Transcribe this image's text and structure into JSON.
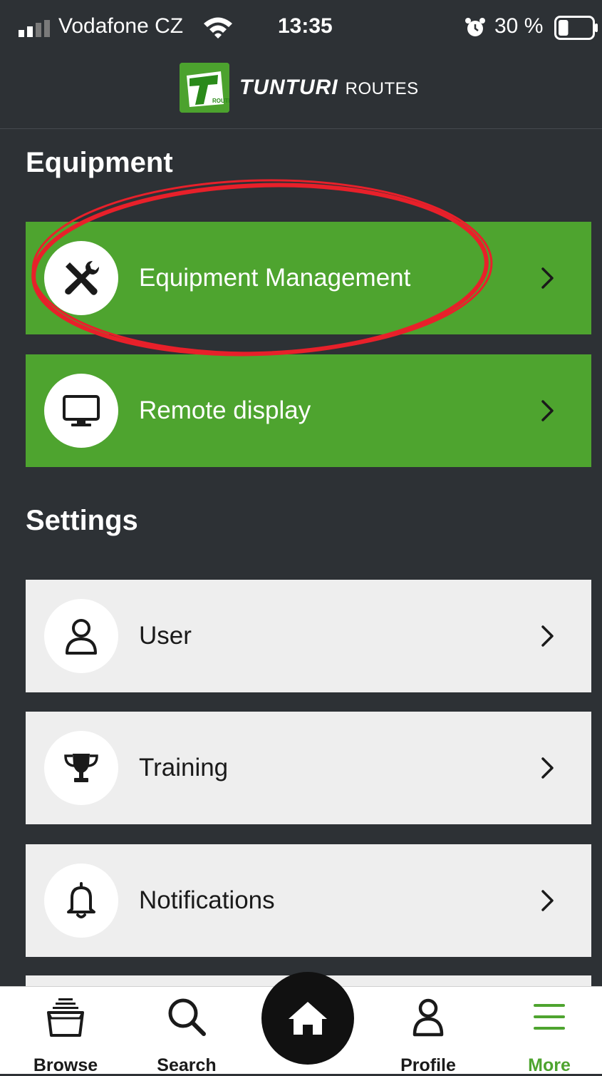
{
  "status_bar": {
    "carrier": "Vodafone CZ",
    "time": "13:35",
    "battery_percent": "30 %",
    "battery_level": 0.3
  },
  "header": {
    "logo_text": "ROUTES",
    "brand_name": "TUNTURI",
    "brand_suffix": "ROUTES"
  },
  "sections": [
    {
      "title": "Equipment",
      "items": [
        {
          "label": "Equipment Management",
          "icon": "tools-icon"
        },
        {
          "label": "Remote display",
          "icon": "monitor-icon"
        }
      ]
    },
    {
      "title": "Settings",
      "items": [
        {
          "label": "User",
          "icon": "user-icon"
        },
        {
          "label": "Training",
          "icon": "trophy-icon"
        },
        {
          "label": "Notifications",
          "icon": "bell-icon"
        }
      ]
    }
  ],
  "tabbar": {
    "tabs": [
      {
        "label": "Browse",
        "icon": "browse-stack-icon"
      },
      {
        "label": "Search",
        "icon": "search-icon"
      },
      {
        "label": "Profile",
        "icon": "profile-icon"
      },
      {
        "label": "More",
        "icon": "menu-icon"
      }
    ],
    "home_icon": "home-icon",
    "active_tab": "More"
  },
  "colors": {
    "background": "#2d3135",
    "accent_green": "#4ea42f",
    "row_light": "#eeeeee",
    "annotation_red": "#e8202a"
  }
}
